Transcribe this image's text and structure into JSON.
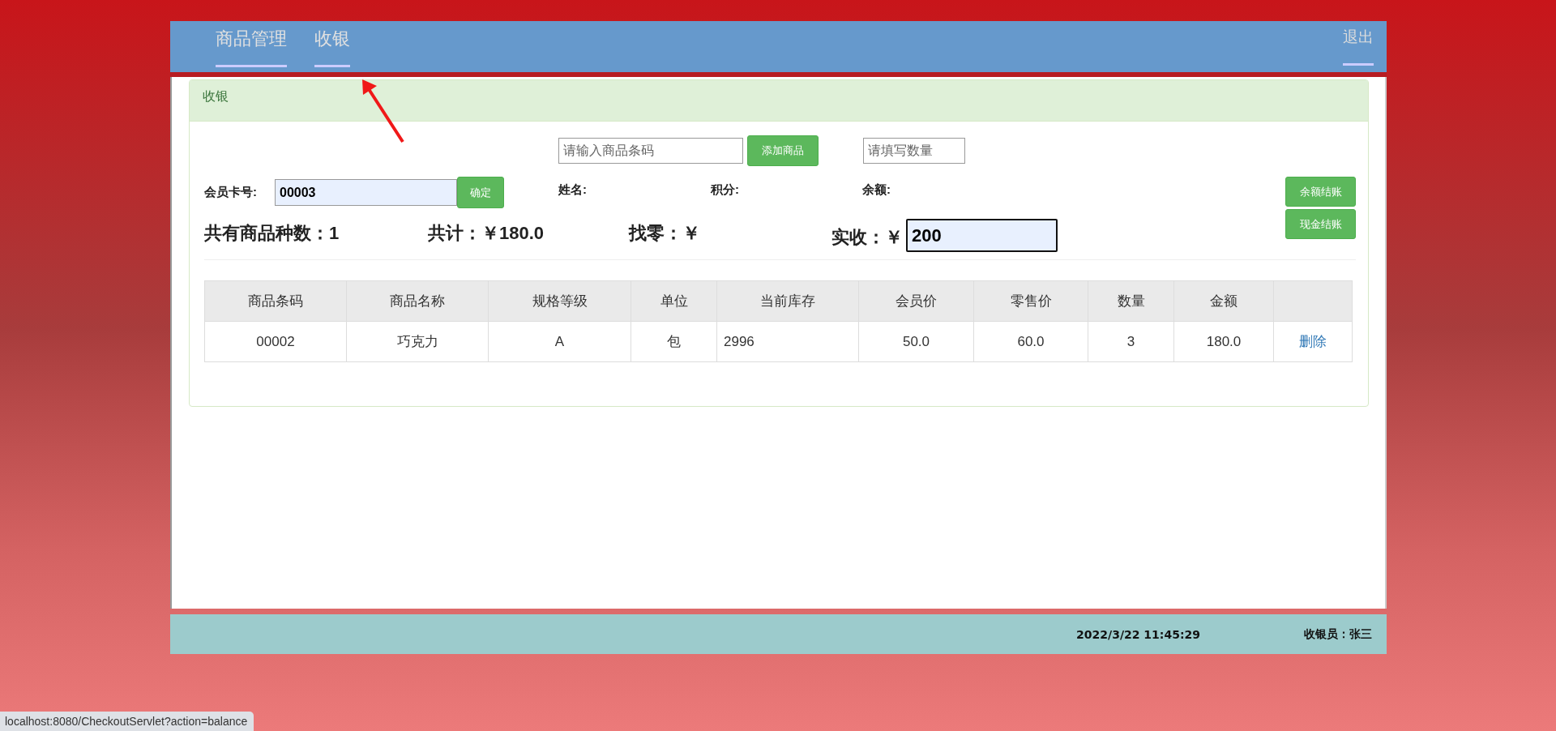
{
  "nav": {
    "tabs": [
      {
        "label": "商品管理"
      },
      {
        "label": "收银"
      }
    ],
    "logout": "退出"
  },
  "panel": {
    "title": "收银",
    "barcode": {
      "placeholder": "请输入商品条码"
    },
    "add_button": "添加商品",
    "quantity": {
      "placeholder": "请填写数量"
    },
    "member": {
      "label": "会员卡号:",
      "value": "00003",
      "confirm": "确定"
    },
    "info_labels": [
      "姓名:",
      "积分:",
      "余额:"
    ],
    "balance_checkout": "余额结账",
    "summary": [
      "共有商品种数：1",
      "共计：￥180.0",
      "找零：￥"
    ],
    "received": {
      "label": "实收：￥",
      "value": "200"
    },
    "cash_checkout": "现金结账",
    "table": {
      "columns": [
        "商品条码",
        "商品名称",
        "规格等级",
        "单位",
        "当前库存",
        "会员价",
        "零售价",
        "数量",
        "金额"
      ],
      "rows": [
        {
          "cells": [
            "00002",
            "巧克力",
            "A",
            "包",
            "2996",
            "50.0",
            "60.0",
            "3",
            "180.0"
          ],
          "action": "删除"
        }
      ]
    }
  },
  "footer": {
    "datetime": "2022/3/22 11:45:29",
    "cashier": "收银员：张三"
  },
  "status_bar": "localhost:8080/CheckoutServlet?action=balance"
}
